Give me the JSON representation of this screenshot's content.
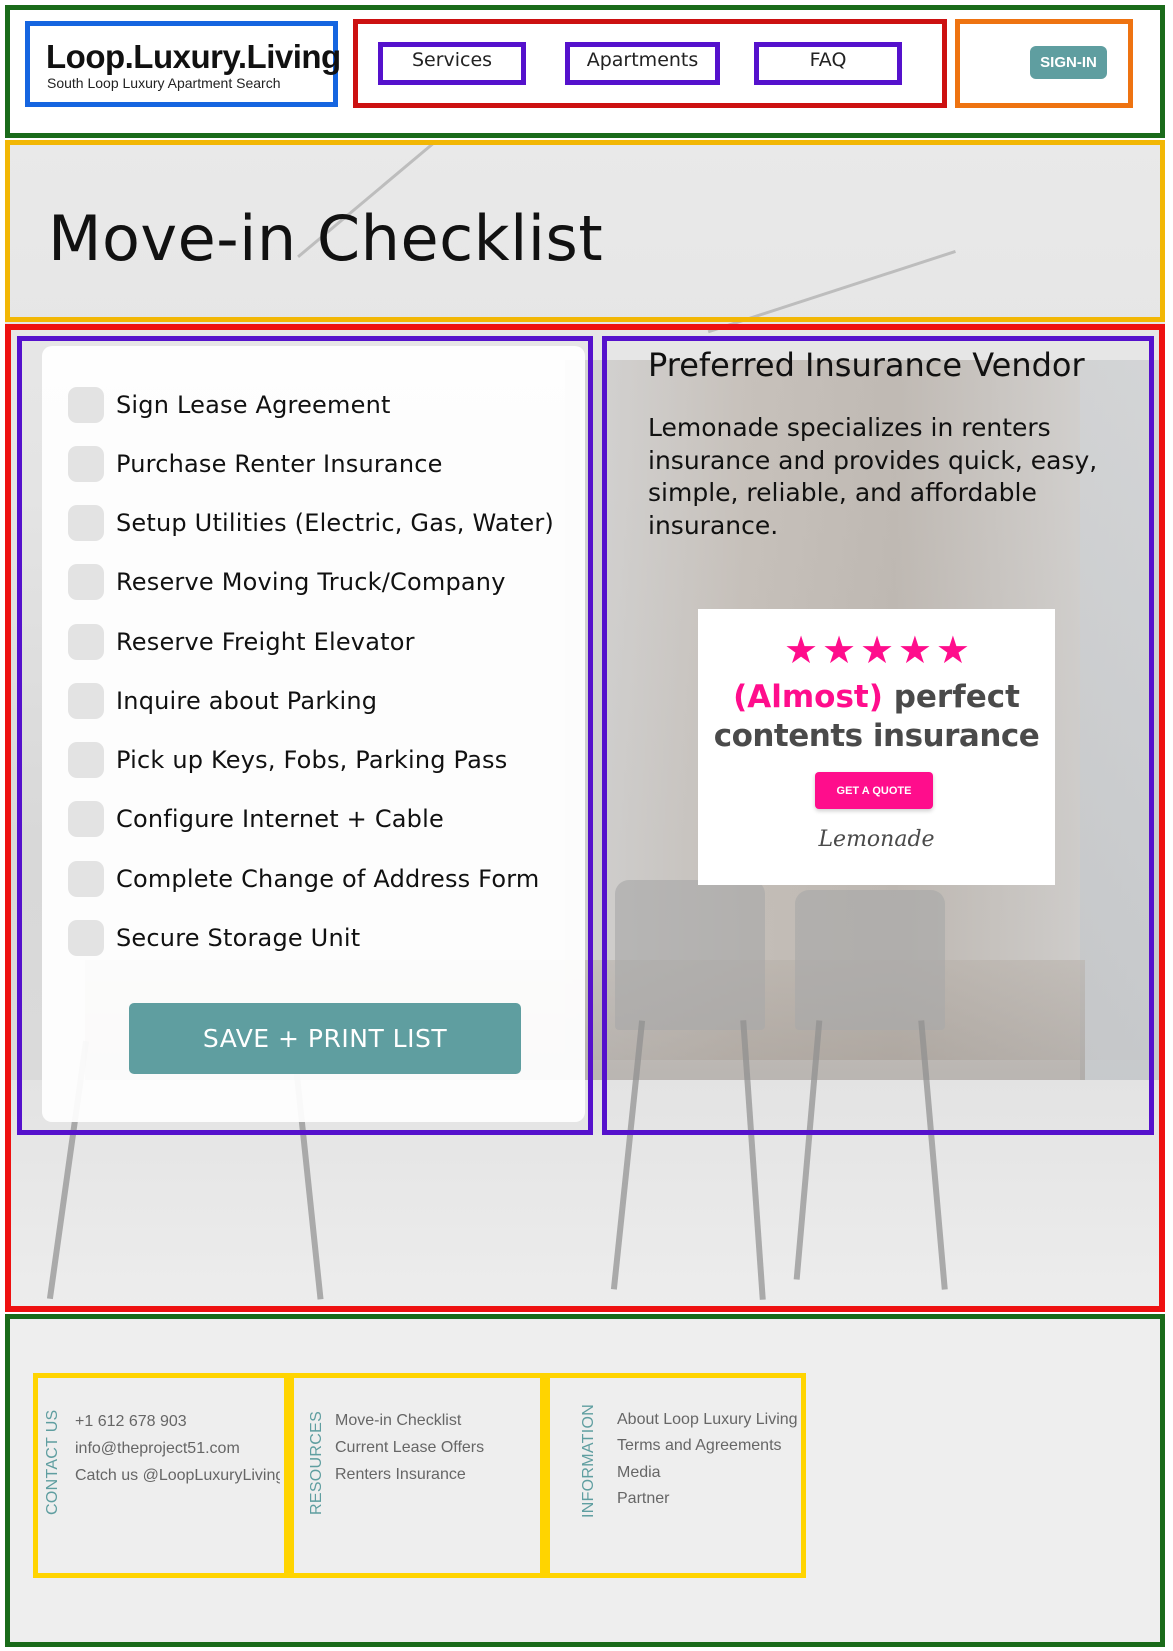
{
  "header": {
    "logo_title": "Loop.Luxury.Living",
    "logo_subtitle": "South Loop Luxury Apartment Search",
    "nav": [
      "Services",
      "Apartments",
      "FAQ"
    ],
    "signin_label": "SIGN-IN"
  },
  "hero": {
    "title": "Move-in Checklist"
  },
  "checklist": {
    "items": [
      "Sign Lease Agreement",
      "Purchase Renter Insurance",
      "Setup Utilities (Electric, Gas, Water)",
      "Reserve Moving Truck/Company",
      "Reserve Freight Elevator",
      "Inquire about Parking",
      "Pick up Keys, Fobs, Parking Pass",
      "Configure Internet + Cable",
      "Complete Change of Address Form",
      "Secure Storage Unit"
    ],
    "save_label": "SAVE + PRINT LIST"
  },
  "vendor": {
    "title": "Preferred Insurance Vendor",
    "description": "Lemonade specializes in renters insurance and provides quick, easy, simple, reliable, and affordable insurance.",
    "ad": {
      "stars": 5,
      "headline_pink": "(Almost)",
      "headline_gray": "perfect",
      "headline_line2": "contents insurance",
      "button": "GET A QUOTE",
      "brand": "Lemonade",
      "accent_color": "#ff0d8c"
    }
  },
  "footer": {
    "contact": {
      "heading": "CONTACT US",
      "lines": [
        "+1 612  678 903",
        "info@theproject51.com",
        "Catch us @LoopLuxuryLiving"
      ]
    },
    "resources": {
      "heading": "RESOURCES",
      "lines": [
        "Move-in Checklist",
        "Current Lease Offers",
        "Renters Insurance"
      ]
    },
    "information": {
      "heading": "INFORMATION",
      "lines": [
        "About Loop Luxury Living",
        "Terms and Agreements",
        "Media",
        "Partner"
      ]
    }
  },
  "colors": {
    "accent_teal": "#5f9ea0",
    "lemonade_pink": "#ff0d8c"
  }
}
